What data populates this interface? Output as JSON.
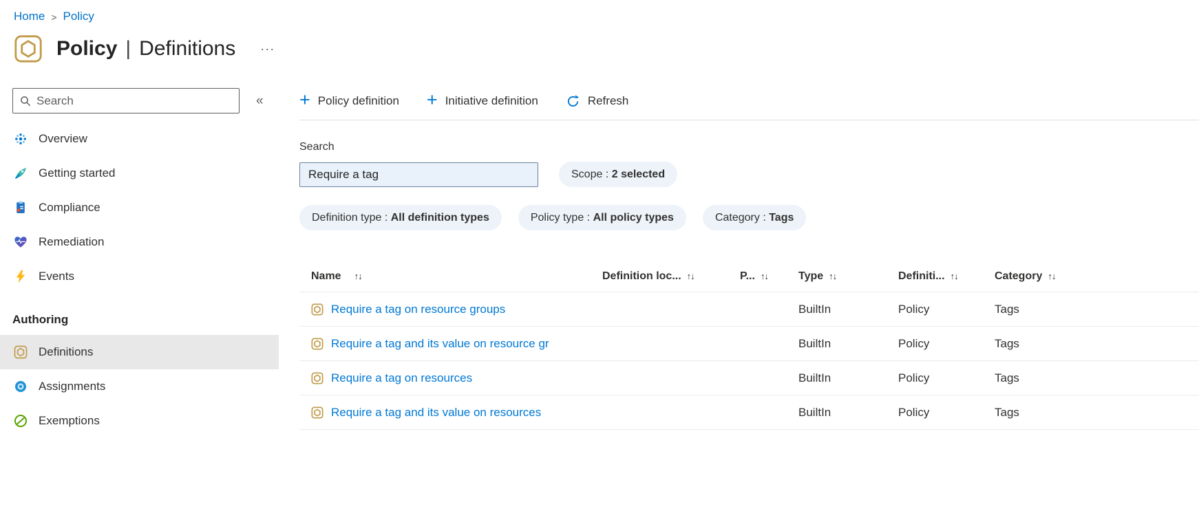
{
  "icons": {
    "breadcrumb_separator": ">",
    "more": "···",
    "collapse": "«",
    "sort": "↑↓",
    "plus": "+",
    "pill_separator": " : "
  },
  "breadcrumb": {
    "home": "Home",
    "policy": "Policy"
  },
  "header": {
    "title_bold": "Policy",
    "title_separator": "|",
    "title_page": "Definitions"
  },
  "sidebar": {
    "search": {
      "placeholder": "Search"
    },
    "items": [
      {
        "label": "Overview"
      },
      {
        "label": "Getting started"
      },
      {
        "label": "Compliance"
      },
      {
        "label": "Remediation"
      },
      {
        "label": "Events"
      }
    ],
    "section": {
      "header": "Authoring",
      "items": [
        {
          "label": "Definitions",
          "selected": true
        },
        {
          "label": "Assignments",
          "selected": false
        },
        {
          "label": "Exemptions",
          "selected": false
        }
      ]
    }
  },
  "toolbar": {
    "policy_definition_label": "Policy definition",
    "initiative_definition_label": "Initiative definition",
    "refresh_label": "Refresh"
  },
  "filters": {
    "search_label": "Search",
    "search_value": "Require a tag",
    "pills": [
      {
        "name": "Scope",
        "value": "2 selected"
      },
      {
        "name": "Definition type",
        "value": "All definition types"
      },
      {
        "name": "Policy type",
        "value": "All policy types"
      },
      {
        "name": "Category",
        "value": "Tags"
      }
    ]
  },
  "table": {
    "columns": [
      {
        "label": "Name"
      },
      {
        "label": "Definition loc..."
      },
      {
        "label": "P..."
      },
      {
        "label": "Type"
      },
      {
        "label": "Definiti..."
      },
      {
        "label": "Category"
      }
    ],
    "rows": [
      {
        "name": "Require a tag on resource groups",
        "definition_location": "",
        "policies": "",
        "type": "BuiltIn",
        "definition_type": "Policy",
        "category": "Tags"
      },
      {
        "name": "Require a tag and its value on resource gr",
        "definition_location": "",
        "policies": "",
        "type": "BuiltIn",
        "definition_type": "Policy",
        "category": "Tags"
      },
      {
        "name": "Require a tag on resources",
        "definition_location": "",
        "policies": "",
        "type": "BuiltIn",
        "definition_type": "Policy",
        "category": "Tags"
      },
      {
        "name": "Require a tag and its value on resources",
        "definition_location": "",
        "policies": "",
        "type": "BuiltIn",
        "definition_type": "Policy",
        "category": "Tags"
      }
    ]
  },
  "colors": {
    "accent_blue": "#0078d4",
    "breadcrumb_blue": "#0072c9",
    "text_dark": "#323130",
    "text_gray": "#605e5c",
    "pill_bg": "#edf3f9",
    "input_bg": "#e9f2fb",
    "selected_item_bg": "#e8e8e8",
    "policy_icon_tan": "#c19a49",
    "events_yellow": "#fcb714",
    "exemptions_green": "#57a300"
  }
}
